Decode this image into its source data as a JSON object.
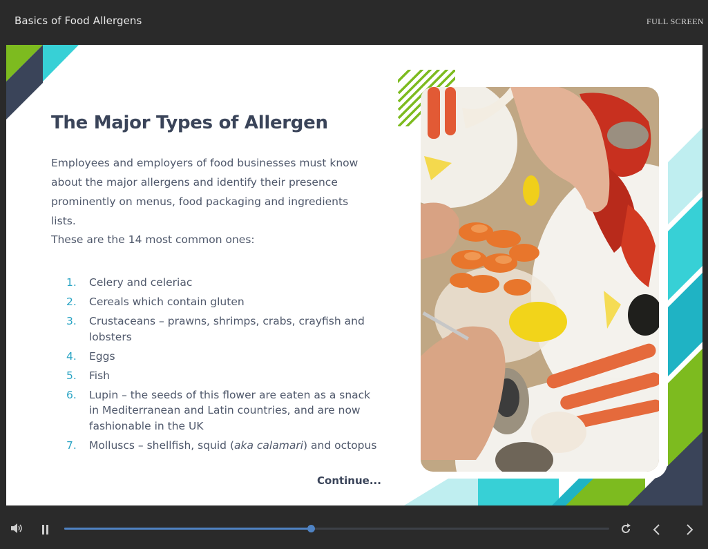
{
  "header": {
    "course_title": "Basics of Food Allergens",
    "fullscreen_label": "FULL SCREEN"
  },
  "slide": {
    "heading": "The Major Types of Allergen",
    "intro": "Employees and employers of food businesses must know about the major allergens and identify their presence prominently on menus, food packaging and ingredients lists.",
    "lead": "These are the 14 most common ones:",
    "allergens": [
      {
        "num": "1.",
        "text": "Celery and celeriac"
      },
      {
        "num": "2.",
        "text": "Cereals which contain gluten"
      },
      {
        "num": "3.",
        "text": "Crustaceans – prawns, shrimps, crabs, crayfish and lobsters"
      },
      {
        "num": "4.",
        "text": "Eggs"
      },
      {
        "num": "5.",
        "text": "Fish"
      },
      {
        "num": "6.",
        "text": "Lupin – the seeds of this flower are eaten as a snack in Mediterranean and  Latin countries, and are now fashionable in the UK"
      },
      {
        "num": "7.",
        "text_before": "Molluscs – shellfish, squid ",
        "text_italic": "aka calamari",
        "text_after": " and octopus"
      }
    ],
    "continue_label": "Continue..."
  },
  "player": {
    "progress": 0.452,
    "buffered": 0.405
  },
  "icons": {
    "volume": "volume-icon",
    "pause": "pause-icon",
    "replay": "replay-icon",
    "prev": "chevron-left-icon",
    "next": "chevron-right-icon",
    "photo": "seafood-platter-photo"
  },
  "colors": {
    "heading": "#3a4459",
    "body_text": "#4f586b",
    "list_numbers": "#2aa4c4",
    "accent_green": "#7dbb1f",
    "accent_cyan": "#37d0d6",
    "accent_navy": "#3a4459",
    "progress": "#4f83c4"
  }
}
